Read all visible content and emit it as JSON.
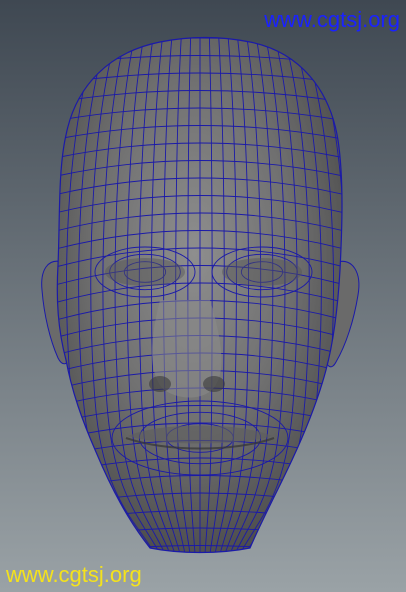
{
  "viewport": {
    "background_top": "#3f4852",
    "background_bottom": "#9aa2a6",
    "mesh_fill": "#7a7a7a",
    "mesh_wire": "#1b1aa8"
  },
  "watermarks": {
    "top_text": "www.cgtsj.org",
    "top_color": "#1a22ff",
    "bottom_text": "www.cgtsj.org",
    "bottom_color": "#f4e21c"
  }
}
